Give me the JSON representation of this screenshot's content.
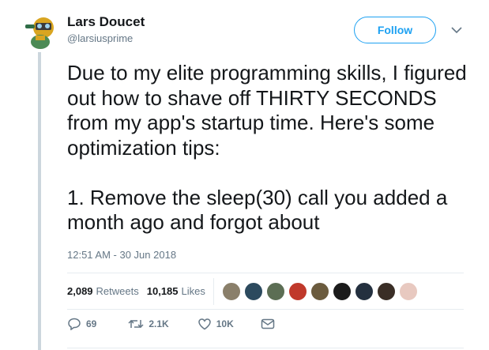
{
  "author": {
    "display_name": "Lars Doucet",
    "handle": "@larsiusprime"
  },
  "follow_label": "Follow",
  "tweet_text": "Due to my elite programming skills, I figured out how to shave off THIRTY SECONDS from my app's startup time. Here's some optimization tips:\n\n1. Remove the sleep(30) call you added a month ago and forgot about",
  "timestamp": "12:51 AM - 30 Jun 2018",
  "stats": {
    "retweets_count": "2,089",
    "retweets_label": "Retweets",
    "likes_count": "10,185",
    "likes_label": "Likes"
  },
  "liker_avatar_colors": [
    "#8a7f6a",
    "#2c4a5e",
    "#5c6e54",
    "#c0392b",
    "#6b5b3e",
    "#1b1b1b",
    "#24303f",
    "#3a2e26",
    "#e8c9c0"
  ],
  "actions": {
    "reply_count": "69",
    "retweet_count": "2.1K",
    "like_count": "10K"
  },
  "icons": [
    "avatar",
    "chevron-down-icon",
    "reply-icon",
    "retweet-icon",
    "like-icon",
    "direct-message-icon"
  ],
  "colors": {
    "accent": "#1da1f2",
    "secondary_text": "#657786",
    "thread_line": "#ccd6dd"
  }
}
